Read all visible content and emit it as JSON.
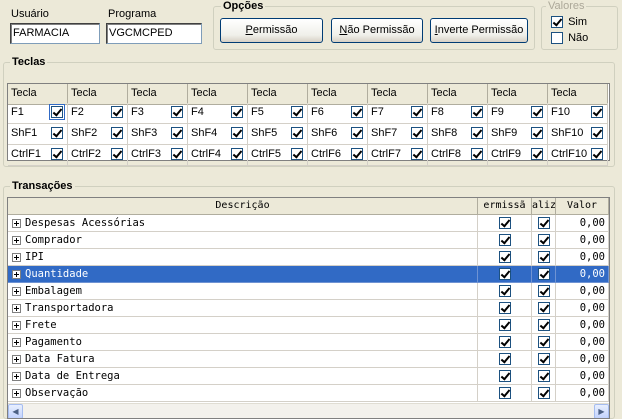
{
  "user_field": {
    "label": "Usuário",
    "value": "FARMACIA"
  },
  "program_field": {
    "label": "Programa",
    "value": "VGCMCPED"
  },
  "options": {
    "title": "Opções",
    "buttons": [
      {
        "prefix": "",
        "mnemonic": "P",
        "rest": "ermissão"
      },
      {
        "prefix": "",
        "mnemonic": "N",
        "rest": "ão Permissão"
      },
      {
        "prefix": "",
        "mnemonic": "I",
        "rest": "nverte Permissão"
      }
    ]
  },
  "values_group": {
    "title": "Valores",
    "items": [
      {
        "label": "Sim",
        "checked": true
      },
      {
        "label": "Não",
        "checked": false
      }
    ]
  },
  "keys": {
    "title": "Teclas",
    "header_label": "Tecla",
    "rows": [
      [
        {
          "k": "F1",
          "c": true
        },
        {
          "k": "F2",
          "c": true
        },
        {
          "k": "F3",
          "c": true
        },
        {
          "k": "F4",
          "c": true
        },
        {
          "k": "F5",
          "c": true
        },
        {
          "k": "F6",
          "c": true
        },
        {
          "k": "F7",
          "c": true
        },
        {
          "k": "F8",
          "c": true
        },
        {
          "k": "F9",
          "c": true
        },
        {
          "k": "F10",
          "c": true
        }
      ],
      [
        {
          "k": "ShF1",
          "c": true
        },
        {
          "k": "ShF2",
          "c": true
        },
        {
          "k": "ShF3",
          "c": true
        },
        {
          "k": "ShF4",
          "c": true
        },
        {
          "k": "ShF5",
          "c": true
        },
        {
          "k": "ShF6",
          "c": true
        },
        {
          "k": "ShF7",
          "c": true
        },
        {
          "k": "ShF8",
          "c": true
        },
        {
          "k": "ShF9",
          "c": true
        },
        {
          "k": "ShF10",
          "c": true
        }
      ],
      [
        {
          "k": "CtrlF1",
          "c": true
        },
        {
          "k": "CtrlF2",
          "c": true
        },
        {
          "k": "CtrlF3",
          "c": true
        },
        {
          "k": "CtrlF4",
          "c": true
        },
        {
          "k": "CtrlF5",
          "c": true
        },
        {
          "k": "CtrlF6",
          "c": true
        },
        {
          "k": "CtrlF7",
          "c": true
        },
        {
          "k": "CtrlF8",
          "c": true
        },
        {
          "k": "CtrlF9",
          "c": true
        },
        {
          "k": "CtrlF10",
          "c": true
        }
      ]
    ]
  },
  "transactions": {
    "title": "Transações",
    "columns": [
      "Descrição",
      "ermissã",
      "aliz",
      "Valor"
    ],
    "selected_index": 3,
    "rows": [
      {
        "desc": "Despesas Acessórias",
        "perm": true,
        "util": true,
        "value": "0,00"
      },
      {
        "desc": "Comprador",
        "perm": true,
        "util": true,
        "value": "0,00"
      },
      {
        "desc": "IPI",
        "perm": true,
        "util": true,
        "value": "0,00"
      },
      {
        "desc": "Quantidade",
        "perm": true,
        "util": true,
        "value": "0,00"
      },
      {
        "desc": "Embalagem",
        "perm": true,
        "util": true,
        "value": "0,00"
      },
      {
        "desc": "Transportadora",
        "perm": true,
        "util": true,
        "value": "0,00"
      },
      {
        "desc": "Frete",
        "perm": true,
        "util": true,
        "value": "0,00"
      },
      {
        "desc": "Pagamento",
        "perm": true,
        "util": true,
        "value": "0,00"
      },
      {
        "desc": "Data Fatura",
        "perm": true,
        "util": true,
        "value": "0,00"
      },
      {
        "desc": "Data de Entrega",
        "perm": true,
        "util": true,
        "value": "0,00"
      },
      {
        "desc": "Observação",
        "perm": true,
        "util": true,
        "value": "0,00"
      }
    ]
  },
  "colors": {
    "selection": "#316ac5",
    "check_green": "#21a121",
    "dialog_bg": "#ece9d8"
  }
}
